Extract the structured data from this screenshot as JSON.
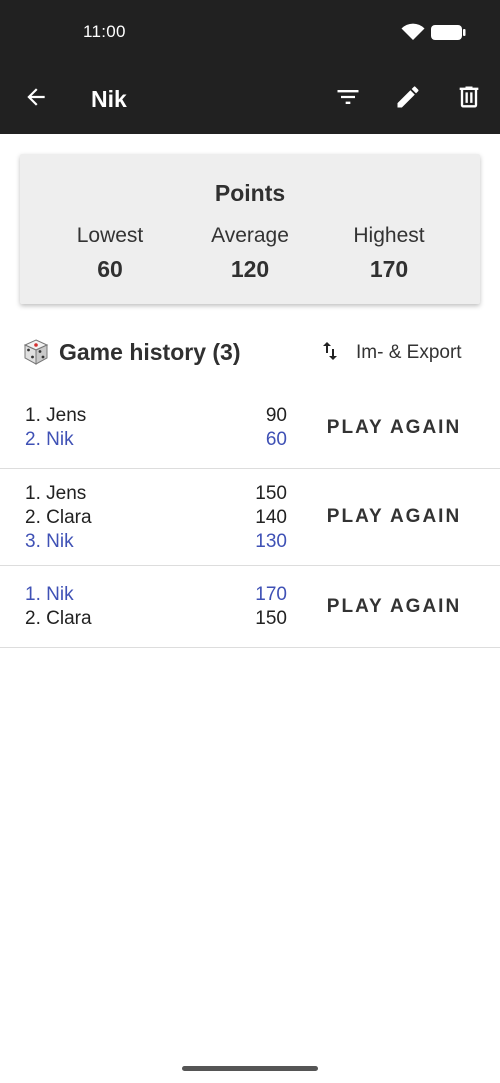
{
  "status_bar": {
    "time": "11:00",
    "icons": [
      "wifi-icon",
      "battery-icon"
    ]
  },
  "app_bar": {
    "title": "Nik",
    "icons": [
      "back-arrow-icon",
      "filter-icon",
      "pencil-icon",
      "trash-icon"
    ]
  },
  "points": {
    "title": "Points",
    "lowest_label": "Lowest",
    "lowest_value": "60",
    "average_label": "Average",
    "average_value": "120",
    "highest_label": "Highest",
    "highest_value": "170"
  },
  "history": {
    "title": "Game history (3)",
    "export_label": "Im- & Export",
    "icons": [
      "dice-icon",
      "swap-vertical-icon"
    ]
  },
  "games": [
    {
      "play_again": "PLAY AGAIN",
      "players": [
        {
          "name": "1. Jens",
          "score": "90",
          "highlight": false
        },
        {
          "name": "2. Nik",
          "score": "60",
          "highlight": true
        }
      ]
    },
    {
      "play_again": "PLAY AGAIN",
      "players": [
        {
          "name": "1. Jens",
          "score": "150",
          "highlight": false
        },
        {
          "name": "2. Clara",
          "score": "140",
          "highlight": false
        },
        {
          "name": "3. Nik",
          "score": "130",
          "highlight": true
        }
      ]
    },
    {
      "play_again": "PLAY AGAIN",
      "players": [
        {
          "name": "1. Nik",
          "score": "170",
          "highlight": true
        },
        {
          "name": "2. Clara",
          "score": "150",
          "highlight": false
        }
      ]
    }
  ],
  "colors": {
    "app_bar": "#212121",
    "highlight": "#3f51b5",
    "card": "#eeeeee"
  }
}
